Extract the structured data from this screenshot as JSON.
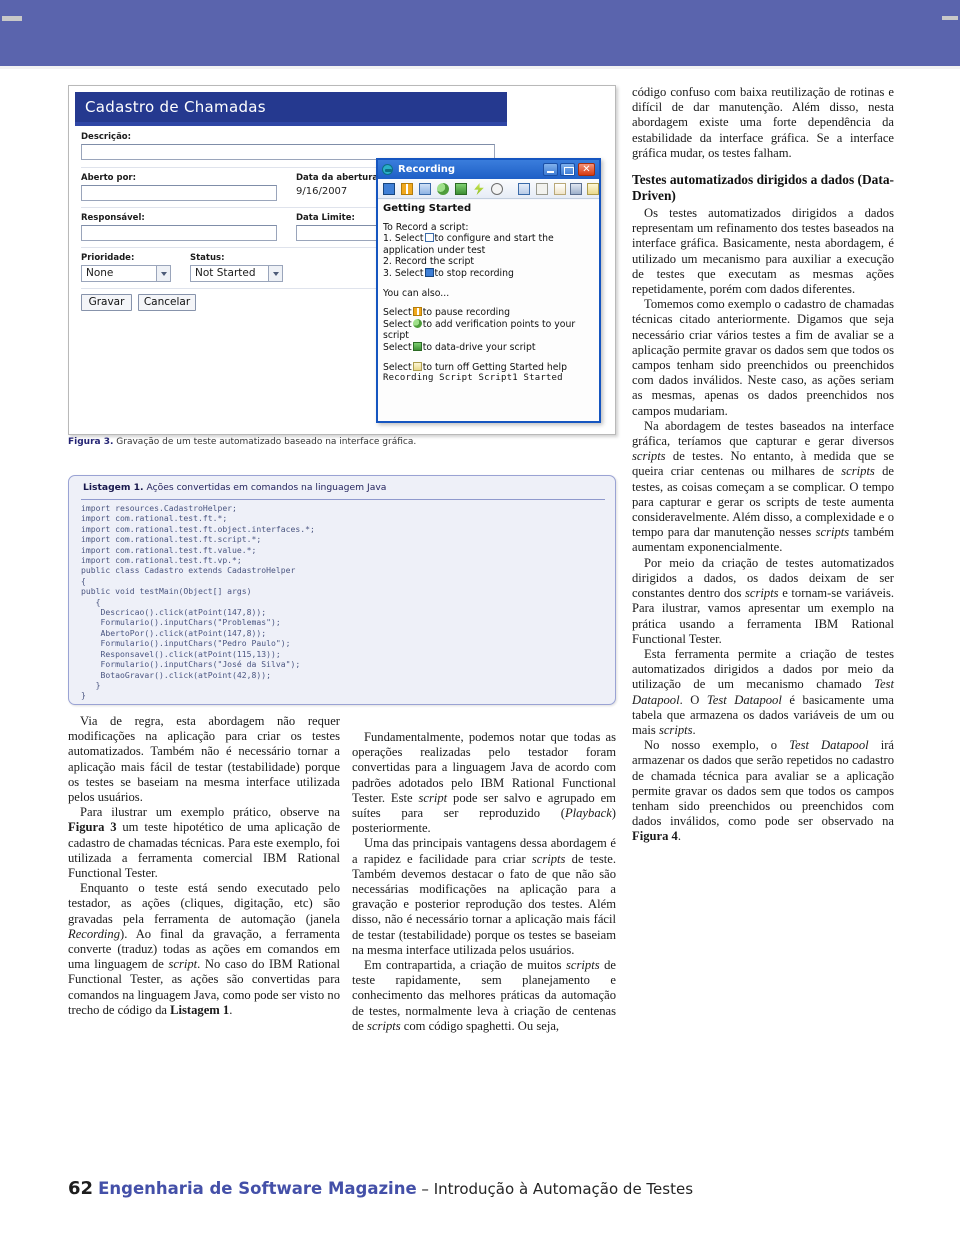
{
  "header": {
    "band_color": "#5a64ad"
  },
  "figure": {
    "caption_label": "Figura 3.",
    "caption_text": " Gravação de um teste automatizado baseado na interface gráfica.",
    "app": {
      "title": "Cadastro de Chamadas",
      "fields": {
        "descricao_label": "Descrição:",
        "aberto_por_label": "Aberto por:",
        "responsavel_label": "Responsável:",
        "prioridade_label": "Prioridade:",
        "status_label": "Status:",
        "data_abertura_label": "Data da abertura:",
        "data_abertura_value": "9/16/2007",
        "data_limite_label": "Data Limite:",
        "prioridade_value": "None",
        "status_value": "Not Started"
      },
      "buttons": {
        "gravar": "Gravar",
        "cancelar": "Cancelar"
      }
    },
    "recording": {
      "window_title": "Recording",
      "min_tip": "_",
      "close_glyph": "✕",
      "heading": "Getting Started",
      "line_to_record": "To Record a script:",
      "step1_a": "1. Select",
      "step1_b": "to configure and start the application under test",
      "step2": "2. Record the script",
      "step3_a": "3. Select",
      "step3_b": "to stop recording",
      "you_can_also": "You can also...",
      "pause_a": "Select",
      "pause_b": "to pause recording",
      "verify_a": "Select",
      "verify_b": "to add verification points to your script",
      "datadrive_a": "Select",
      "datadrive_b": "to data-drive your script",
      "turnoff_a": "Select",
      "turnoff_b": "to turn off Getting Started help",
      "status_line": "Recording Script Script1 Started"
    }
  },
  "listing": {
    "label": "Listagem 1.",
    "title": " Ações convertidas em comandos na linguagem Java",
    "code": "import resources.CadastroHelper;\nimport com.rational.test.ft.*;\nimport com.rational.test.ft.object.interfaces.*;\nimport com.rational.test.ft.script.*;\nimport com.rational.test.ft.value.*;\nimport com.rational.test.ft.vp.*;\npublic class Cadastro extends CadastroHelper\n{\npublic void testMain(Object[] args)\n   {\n    Descricao().click(atPoint(147,8));\n    Formulario().inputChars(\"Problemas\");\n    AbertoPor().click(atPoint(147,8));\n    Formulario().inputChars(\"Pedro Paulo\");\n    Responsavel().click(atPoint(115,13));\n    Formulario().inputChars(\"José da Silva\");\n    BotaoGravar().click(atPoint(42,8));\n   }\n}"
  },
  "columns": {
    "col1": {
      "p1": "Via de regra, esta abordagem não requer modificações na aplicação para criar os testes automatizados. Também não é necessário tornar a aplicação mais fácil de testar (testabilidade) porque os testes se baseiam na mesma interface utilizada pelos usuários.",
      "p2_a": "Para ilustrar um exemplo prático, observe na ",
      "p2_b": "Figura 3",
      "p2_c": " um teste hipotético de uma aplicação de cadastro de chamadas técnicas. Para este exemplo, foi utilizada a ferramenta comercial IBM Rational Functional Tester.",
      "p3_a": "Enquanto o teste está sendo executado pelo testador, as ações (cliques, digitação, etc) são gravadas pela ferramenta de automação (janela ",
      "p3_b": "Recording",
      "p3_c": "). Ao final da gravação, a ferramenta converte (traduz) todas as ações em comandos em uma linguagem de ",
      "p3_d": "script",
      "p3_e": ". No caso do IBM Rational Functional Tester, as ações são convertidas para comandos na linguagem Java, como pode ser visto no trecho de código da ",
      "p3_f": "Listagem 1",
      "p3_g": "."
    },
    "col2": {
      "p1_a": "Fundamentalmente, podemos notar que todas as operações realizadas pelo testador foram convertidas para a linguagem Java de acordo com padrões adotados pelo IBM Rational Functional Tester. Este ",
      "p1_b": "script",
      "p1_c": " pode ser salvo e agrupado em suítes para ser reproduzido (",
      "p1_d": "Playback",
      "p1_e": ") posteriormente.",
      "p2_a": "Uma das principais vantagens dessa abordagem é a rapidez e facilidade para criar ",
      "p2_b": "scripts",
      "p2_c": " de teste. Também devemos destacar o fato de que não são necessárias modificações na aplicação para a gravação e posterior reprodução dos testes. Além disso, não é necessário tornar a aplicação mais fácil de testar (testabilidade) porque os testes se baseiam na mesma interface utilizada pelos usuários.",
      "p3_a": "Em contrapartida, a criação de muitos ",
      "p3_b": "scripts",
      "p3_c": " de teste rapidamente, sem planejamento e conhecimento das melhores práticas da automação de testes, normalmente leva à criação de centenas de ",
      "p3_d": "scripts",
      "p3_e": " com código spaghetti. Ou seja,"
    },
    "col3": {
      "p1": "código confuso com baixa reutilização de rotinas e difícil de dar manutenção. Além disso, nesta abordagem existe uma forte dependência da estabilidade da interface gráfica. Se a interface gráfica mudar, os testes falham.",
      "heading": "Testes automatizados dirigidos a dados (Data-Driven)",
      "p2": "Os testes automatizados dirigidos a dados representam um refinamento dos testes baseados na interface gráfica. Basicamente, nesta abordagem, é utilizado um mecanismo para auxiliar a execução de testes que executam as mesmas ações repetidamente, porém com dados diferentes.",
      "p3": "Tomemos como exemplo o cadastro de chamadas técnicas citado anteriormente. Digamos que seja necessário criar vários testes a fim de avaliar se a aplicação permite gravar os dados sem que todos os campos tenham sido preenchidos ou preenchidos com dados inválidos. Neste caso, as ações seriam as mesmas, apenas os dados preenchidos nos campos mudariam.",
      "p4_a": "Na abordagem de testes baseados na interface gráfica, teríamos que capturar e gerar diversos ",
      "p4_b": "scripts",
      "p4_c": " de testes. No entanto, à medida que se queira criar centenas ou milhares de ",
      "p4_d": "scripts",
      "p4_e": " de testes, as coisas começam a se complicar. O tempo para capturar e gerar os scripts de teste aumenta consideravelmente. Além disso, a complexidade e o tempo para dar manutenção nesses ",
      "p4_f": "scripts",
      "p4_g": " também aumentam exponencialmente.",
      "p5_a": "Por meio da criação de testes automatizados dirigidos a dados, os dados deixam de ser constantes dentro dos ",
      "p5_b": "scripts",
      "p5_c": " e tornam-se variáveis. Para ilustrar, vamos apresentar um exemplo na prática usando a ferramenta IBM Rational Functional Tester.",
      "p6_a": "Esta ferramenta permite a criação de testes automatizados dirigidos a dados por meio da utilização de um mecanismo chamado ",
      "p6_b": "Test Datapool",
      "p6_c": ". O ",
      "p6_d": "Test Datapool",
      "p6_e": " é basicamente uma tabela que armazena os dados variáveis de um ou mais ",
      "p6_f": "scripts",
      "p6_g": ".",
      "p7_a": "No nosso exemplo, o ",
      "p7_b": "Test Datapool",
      "p7_c": " irá armazenar os dados que serão repetidos no cadastro de chamada técnica para avaliar se a aplicação permite gravar os dados sem que todos os campos tenham sido preenchidos ou preenchidos com dados inválidos, como pode ser observado na ",
      "p7_d": "Figura 4",
      "p7_e": "."
    }
  },
  "footer": {
    "page_number": "62",
    "magazine": "Engenharia de Software Magazine",
    "separator": " – ",
    "article": "Introdução à Automação de Testes",
    "magazine_color": "#4450a8"
  }
}
